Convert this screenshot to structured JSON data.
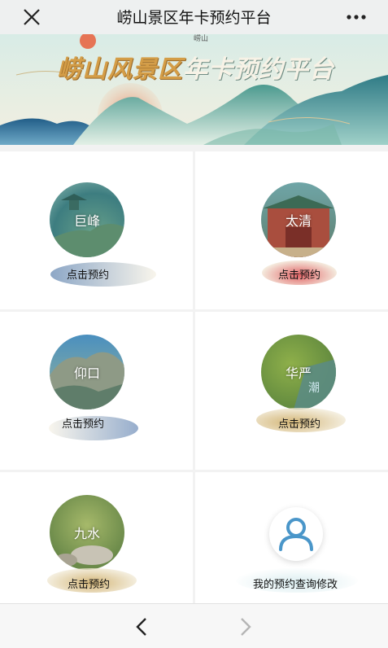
{
  "topbar": {
    "title": "崂山景区年卡预约平台"
  },
  "banner": {
    "title_part1": "崂山风景区",
    "title_part2": "年卡预约平台",
    "sub": "崂山"
  },
  "cells": [
    {
      "name": "巨峰",
      "action": "点击预约"
    },
    {
      "name": "太清",
      "action": "点击预约"
    },
    {
      "name": "仰口",
      "action": "点击预约"
    },
    {
      "name": "华严",
      "action": "点击预约"
    },
    {
      "name": "九水",
      "action": "点击预约"
    },
    {
      "name": "",
      "action": "我的预约查询修改"
    }
  ],
  "colors": {
    "banner_gold": "#d49d47",
    "teal": "#3a8a86",
    "accent_blue": "#4a96c9"
  }
}
